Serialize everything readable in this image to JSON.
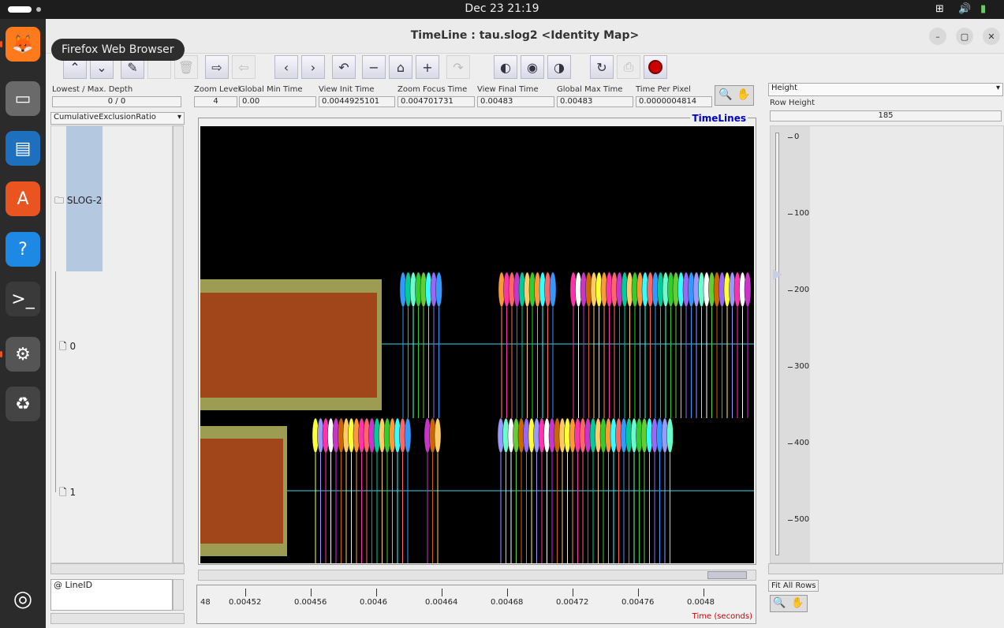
{
  "topbar": {
    "clock": "Dec 23  21:19"
  },
  "dock": {
    "tooltip": "Firefox Web Browser",
    "items": [
      {
        "name": "firefox-icon",
        "glyph": "🦊",
        "color": "#ff7a1a"
      },
      {
        "name": "files-icon",
        "glyph": "▭",
        "color": "#6a6a6a"
      },
      {
        "name": "writer-icon",
        "glyph": "▤",
        "color": "#1f6fbf"
      },
      {
        "name": "software-icon",
        "glyph": "A",
        "color": "#e95420"
      },
      {
        "name": "help-icon",
        "glyph": "?",
        "color": "#1e88e5"
      },
      {
        "name": "terminal-icon",
        "glyph": ">_",
        "color": "#3a3a3a"
      },
      {
        "name": "settings-icon",
        "glyph": "⚙",
        "color": "#555"
      },
      {
        "name": "trash-icon",
        "glyph": "♻",
        "color": "#444"
      }
    ]
  },
  "window": {
    "title": "TimeLine : tau.slog2  <Identity Map>"
  },
  "left": {
    "depth_label": "Lowest / Max. Depth",
    "depth_value": "0 / 0",
    "metric_select": "CumulativeExclusionRatio",
    "root_label": "SLOG-2",
    "rows": [
      "0",
      "1"
    ],
    "lineid": "@ LineID"
  },
  "info": [
    {
      "label": "Zoom Level",
      "value": "4"
    },
    {
      "label": "Global Min Time",
      "value": "0.00"
    },
    {
      "label": "View  Init Time",
      "value": "0.0044925101"
    },
    {
      "label": "Zoom Focus Time",
      "value": "0.004701731"
    },
    {
      "label": "View Final Time",
      "value": "0.00483"
    },
    {
      "label": "Global Max Time",
      "value": "0.00483"
    },
    {
      "label": "Time Per Pixel",
      "value": "0.0000004814"
    }
  ],
  "canvas": {
    "title": "TimeLines"
  },
  "ruler": {
    "ticks": [
      "48",
      "0.00452",
      "0.00456",
      "0.0046",
      "0.00464",
      "0.00468",
      "0.00472",
      "0.00476",
      "0.0048"
    ],
    "unit": "Time (seconds)"
  },
  "right": {
    "height_select": "Height",
    "row_height_label": "Row Height",
    "row_height_value": "185",
    "slider_ticks": [
      "0",
      "100",
      "200",
      "300",
      "400",
      "500"
    ],
    "fit_rows": "Fit All Rows"
  },
  "colors": {
    "state_fill": "#a0461a",
    "state_border": "#9c9c52",
    "timeline": "#3ad6e6",
    "ellipses": [
      "#cc33cc",
      "#3399ff",
      "#ffff33",
      "#33cc33",
      "#ffffff",
      "#ff6666",
      "#9966ff",
      "#ffcc66",
      "#66ffcc",
      "#ff33aa",
      "#33ffff",
      "#cc6600",
      "#00cc99",
      "#9999ff",
      "#ff9933",
      "#66cc33"
    ]
  }
}
